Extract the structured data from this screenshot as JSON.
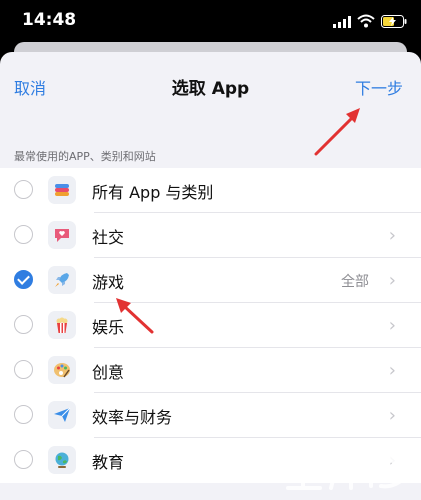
{
  "status": {
    "time": "14:48"
  },
  "nav": {
    "cancel": "取消",
    "title": "选取 App",
    "next": "下一步"
  },
  "section_header": "最常使用的APP、类别和网站",
  "items": [
    {
      "label": "所有 App 与类别",
      "icon": "stack-icon",
      "checked": false,
      "detail": ""
    },
    {
      "label": "社交",
      "icon": "chat-bubble-icon",
      "checked": false,
      "detail": ""
    },
    {
      "label": "游戏",
      "icon": "rocket-icon",
      "checked": true,
      "detail": "全部"
    },
    {
      "label": "娱乐",
      "icon": "popcorn-icon",
      "checked": false,
      "detail": ""
    },
    {
      "label": "创意",
      "icon": "palette-icon",
      "checked": false,
      "detail": ""
    },
    {
      "label": "效率与财务",
      "icon": "paper-plane-icon",
      "checked": false,
      "detail": ""
    },
    {
      "label": "教育",
      "icon": "globe-icon",
      "checked": false,
      "detail": ""
    }
  ],
  "colors": {
    "accent": "#2f7de1",
    "annotation": "#e23232"
  }
}
